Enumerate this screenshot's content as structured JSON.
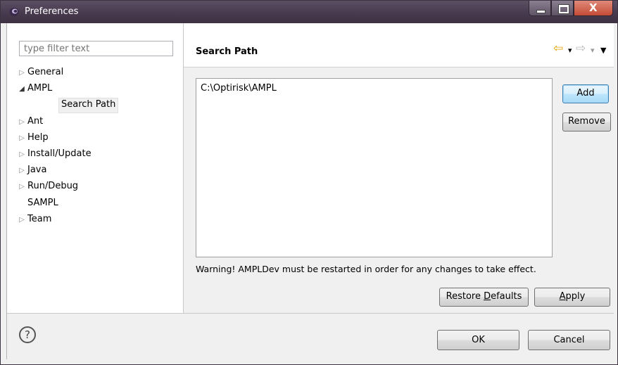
{
  "window": {
    "title": "Preferences",
    "minimize_glyph": "–",
    "maximize_glyph": "□",
    "close_glyph": "X"
  },
  "filter": {
    "placeholder": "type filter text"
  },
  "tree": [
    {
      "label": "General",
      "expand": "▷",
      "indent": 0
    },
    {
      "label": "AMPL",
      "expand": "◢",
      "indent": 0
    },
    {
      "label": "Search Path",
      "expand": "",
      "indent": 1,
      "selected": true
    },
    {
      "label": "Ant",
      "expand": "▷",
      "indent": 0
    },
    {
      "label": "Help",
      "expand": "▷",
      "indent": 0
    },
    {
      "label": "Install/Update",
      "expand": "▷",
      "indent": 0
    },
    {
      "label": "Java",
      "expand": "▷",
      "indent": 0
    },
    {
      "label": "Run/Debug",
      "expand": "▷",
      "indent": 0
    },
    {
      "label": "SAMPL",
      "expand": "",
      "indent": 0
    },
    {
      "label": "Team",
      "expand": "▷",
      "indent": 0
    }
  ],
  "page": {
    "title": "Search Path",
    "nav": {
      "back": "⇦",
      "back_menu": "▾",
      "forward": "⇨",
      "forward_menu": "▾",
      "view_menu": "▼"
    },
    "paths": [
      "C:\\Optirisk\\AMPL"
    ],
    "add_label": "Add",
    "remove_label": "Remove",
    "warning": "Warning! AMPLDev must be restarted in order for any changes to take effect.",
    "restore_label_pre": "Restore ",
    "restore_label_mnemonic": "D",
    "restore_label_post": "efaults",
    "apply_label_mnemonic": "A",
    "apply_label_post": "pply"
  },
  "footer": {
    "help_glyph": "?",
    "ok_label": "OK",
    "cancel_label": "Cancel"
  },
  "colors": {
    "nav_back": "#e8a000",
    "nav_forward": "#b8b8b8",
    "title_bar": "#46394d"
  }
}
